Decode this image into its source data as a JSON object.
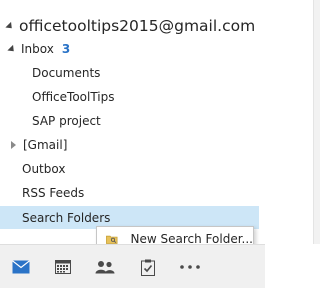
{
  "account": {
    "email": "officetooltips2015@gmail.com"
  },
  "folders": {
    "inbox": {
      "label": "Inbox",
      "unread": "3"
    },
    "inbox_children": [
      {
        "label": "Documents"
      },
      {
        "label": "OfficeToolTips"
      },
      {
        "label": "SAP project"
      }
    ],
    "gmail": {
      "label": "[Gmail]"
    },
    "outbox": {
      "label": "Outbox"
    },
    "rss": {
      "label": "RSS Feeds"
    },
    "search_folders": {
      "label": "Search Folders"
    }
  },
  "context_menu": {
    "new_search_folder": "New Search Folder..."
  },
  "nav": {
    "items": [
      {
        "icon": "mail-icon",
        "active": true
      },
      {
        "icon": "calendar-icon",
        "active": false
      },
      {
        "icon": "people-icon",
        "active": false
      },
      {
        "icon": "tasks-icon",
        "active": false
      },
      {
        "icon": "more-icon",
        "active": false
      }
    ]
  },
  "colors": {
    "accent": "#2a73c7",
    "selection": "#cde6f7",
    "bottombar": "#f0f0f0"
  }
}
